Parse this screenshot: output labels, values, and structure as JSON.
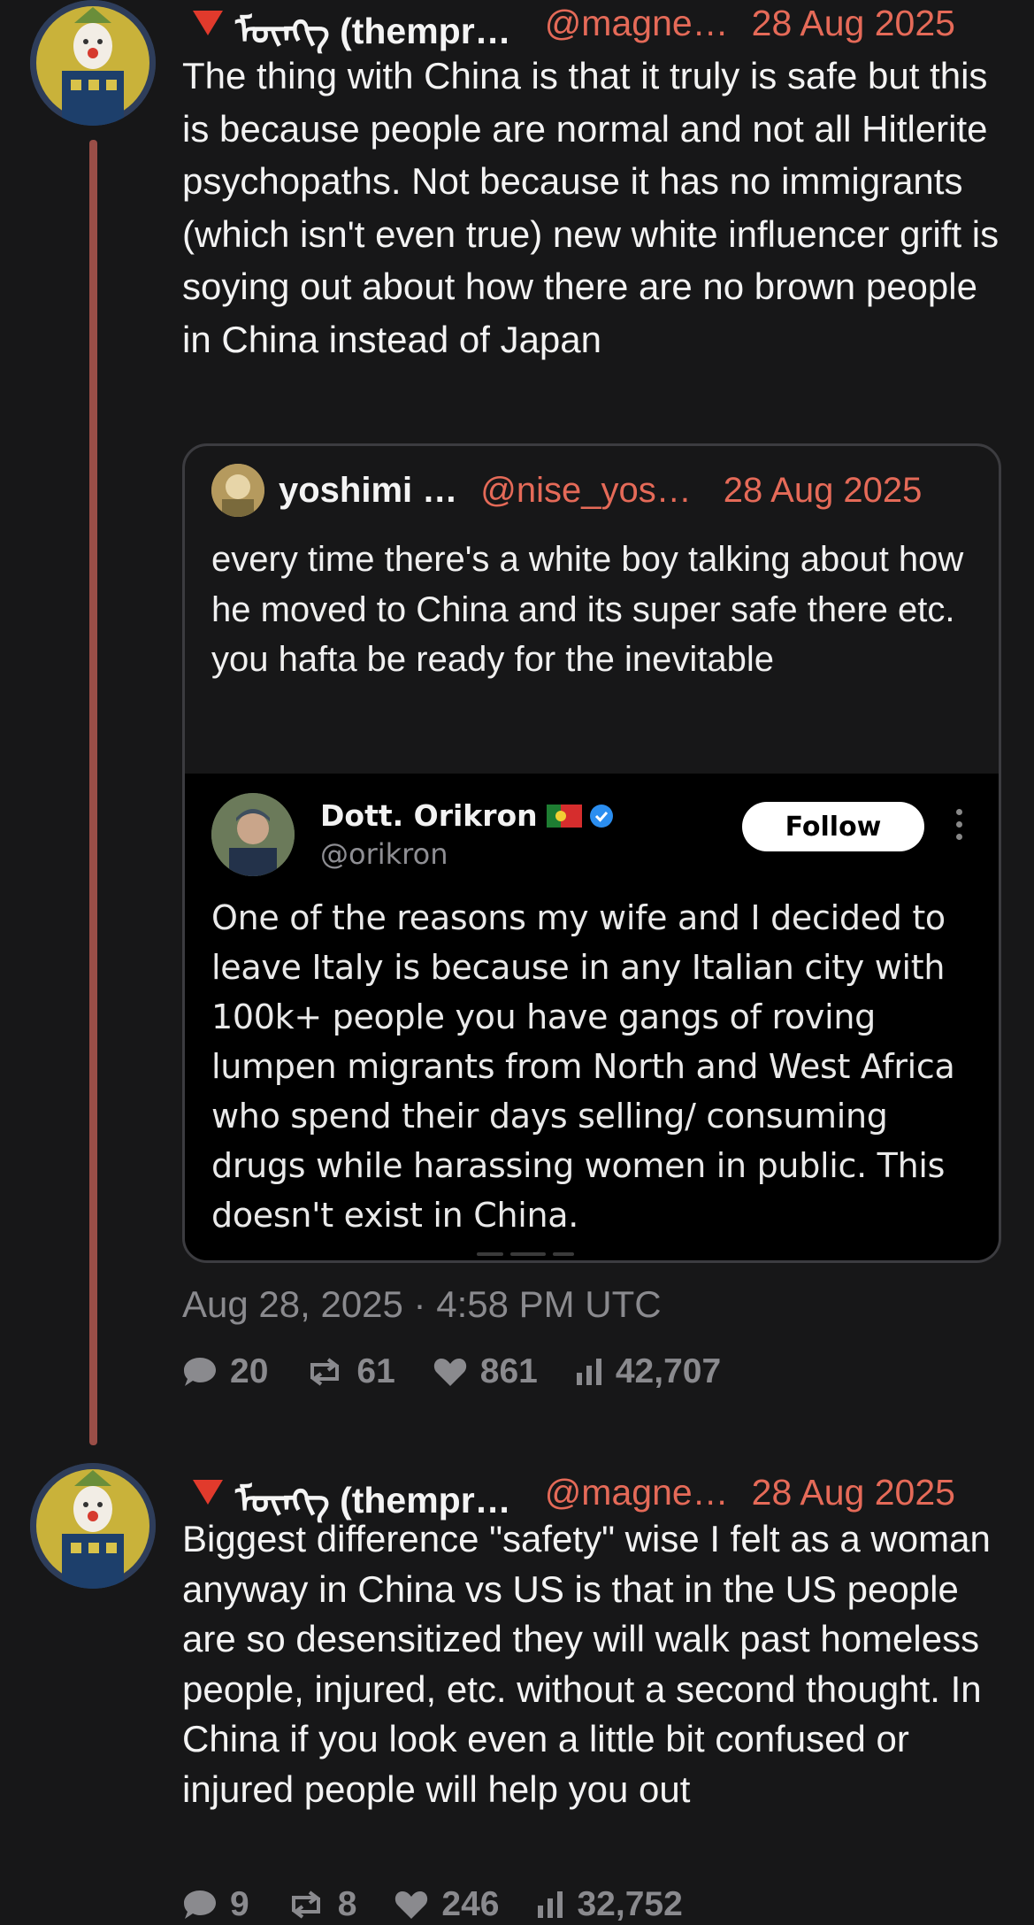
{
  "colors": {
    "background": "#171718",
    "accent_handle": "#e56a58",
    "thread_line": "#9a4e47",
    "muted": "#8a8a8e"
  },
  "posts": [
    {
      "display_name": "ᠮᠦᠩᠭ (thempr…",
      "handle": "@magne…",
      "date": "28 Aug 2025",
      "text": "The thing with China is that it truly is safe but this is because people are normal and not all Hitlerite psychopaths. Not because it has no immigrants (which isn't even true) new white influencer grift is soying out about how there are no brown people in China instead of Japan",
      "quote": {
        "display_name": "yoshimi …",
        "handle": "@nise_yos…",
        "date": "28 Aug 2025",
        "text": "every time there's a white boy talking about how he moved to China and its super safe there etc. you hafta be ready for the inevitable",
        "embedded_post": {
          "display_name": "Dott. Orikron",
          "handle": "@orikron",
          "follow_label": "Follow",
          "text": "One of the reasons my wife and I decided to leave Italy is because in any Italian city with 100k+ people you have gangs of roving lumpen migrants from North and West Africa who spend their days selling/ consuming drugs while harassing women in public. This doesn't exist in China."
        }
      },
      "timestamp": "Aug 28, 2025 · 4:58 PM UTC",
      "stats": {
        "replies": "20",
        "reposts": "61",
        "likes": "861",
        "views": "42,707"
      }
    },
    {
      "display_name": "ᠮᠦᠩᠭ (thempr…",
      "handle": "@magne…",
      "date": "28 Aug 2025",
      "text": "Biggest difference \"safety\" wise I felt as a woman anyway in China vs US is that in the US people are so desensitized they will walk past homeless people, injured, etc. without a second thought. In China if you look even a little bit confused or injured people will help you out",
      "stats": {
        "replies": "9",
        "reposts": "8",
        "likes": "246",
        "views": "32,752"
      }
    }
  ]
}
